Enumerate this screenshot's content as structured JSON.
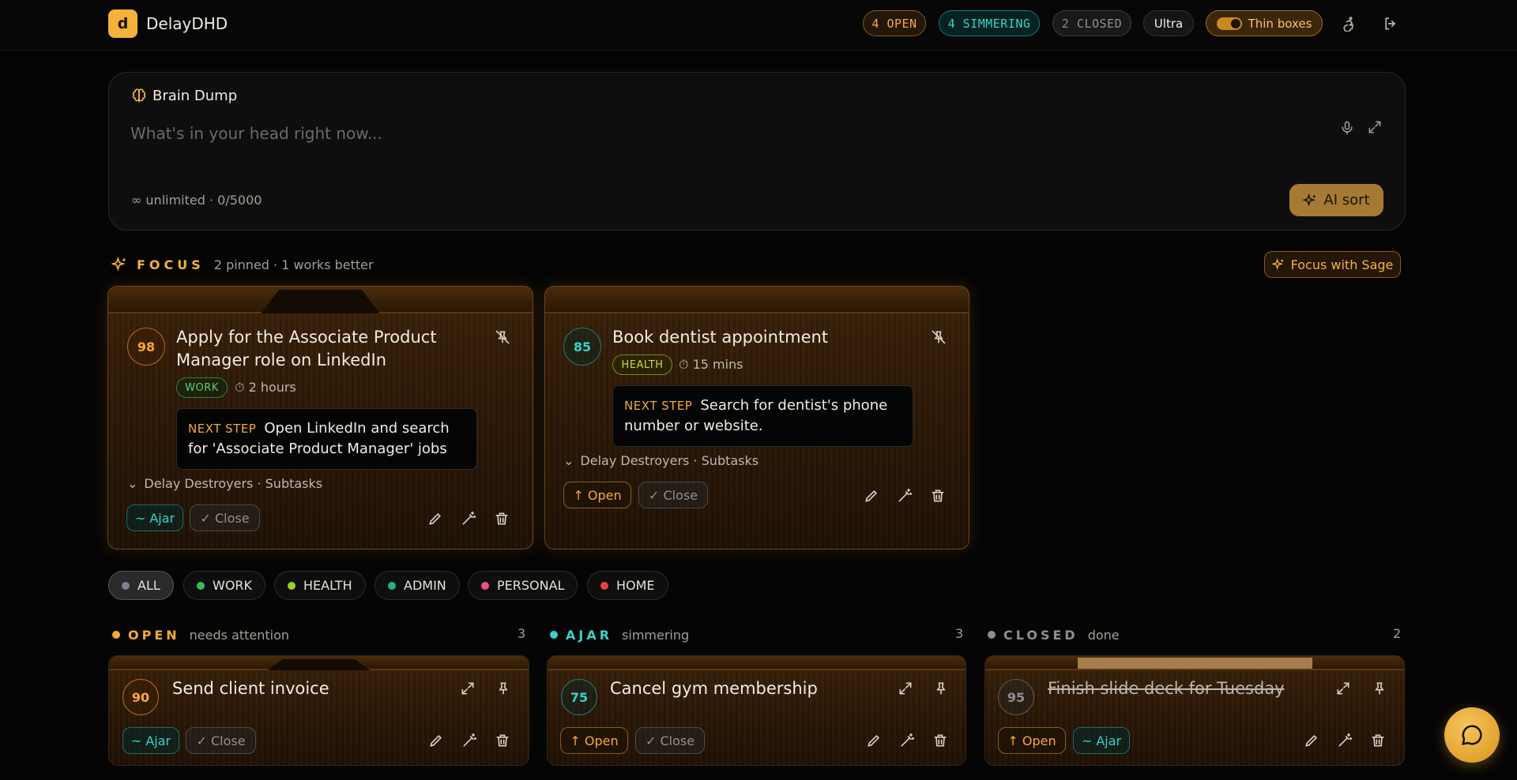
{
  "app": {
    "logo_letter": "d",
    "name": "DelayDHD"
  },
  "header": {
    "open_label": "4 OPEN",
    "simmering_label": "4 SIMMERING",
    "closed_label": "2 CLOSED",
    "plan_label": "Ultra",
    "thin_boxes_label": "Thin boxes",
    "icons": [
      "accessibility-icon",
      "logout-icon"
    ]
  },
  "brain_dump": {
    "title": "Brain Dump",
    "placeholder": "What's in your head right now...",
    "value": "",
    "counter": "∞ unlimited · 0/5000",
    "ai_sort_label": "AI sort"
  },
  "focus": {
    "label": "FOCUS",
    "subtitle": "2 pinned · 1 works better",
    "sage_label": "Focus with Sage",
    "cards": [
      {
        "score": "98",
        "title": "Apply for the Associate Product Manager role on LinkedIn",
        "tag": "WORK",
        "duration": "⏱ 2 hours",
        "next_label": "NEXT STEP",
        "next_text": "Open LinkedIn and search for 'Associate Product Manager' jobs",
        "delay": "Delay Destroyers · Subtasks",
        "btn1": "~ Ajar",
        "btn2": "✓ Close"
      },
      {
        "score": "85",
        "title": "Book dentist appointment",
        "tag": "HEALTH",
        "duration": "⏱ 15 mins",
        "next_label": "NEXT STEP",
        "next_text": "Search for dentist's phone number or website.",
        "delay": "Delay Destroyers · Subtasks",
        "btn1": "↑ Open",
        "btn2": "✓ Close"
      }
    ]
  },
  "filters": [
    {
      "label": "ALL",
      "color": "#7c8190"
    },
    {
      "label": "WORK",
      "color": "#2fbf57"
    },
    {
      "label": "HEALTH",
      "color": "#9bcf2a"
    },
    {
      "label": "ADMIN",
      "color": "#1fb57a"
    },
    {
      "label": "PERSONAL",
      "color": "#ec4f8c"
    },
    {
      "label": "HOME",
      "color": "#e5423a"
    }
  ],
  "columns": [
    {
      "label": "OPEN",
      "sub": "needs attention",
      "count": "3",
      "color": "#f4a93a",
      "card": {
        "score": "90",
        "title": "Send client invoice",
        "btn1": "~ Ajar",
        "btn2": "✓ Close"
      }
    },
    {
      "label": "AJAR",
      "sub": "simmering",
      "count": "3",
      "color": "#37d3c6",
      "card": {
        "score": "75",
        "title": "Cancel gym membership",
        "btn1": "↑ Open",
        "btn2": "✓ Close"
      }
    },
    {
      "label": "CLOSED",
      "sub": "done",
      "count": "2",
      "color": "#8f8f8f",
      "card": {
        "score": "95",
        "title": "Finish slide deck for Tuesday",
        "btn1": "↑ Open",
        "btn2": "~ Ajar"
      }
    }
  ]
}
